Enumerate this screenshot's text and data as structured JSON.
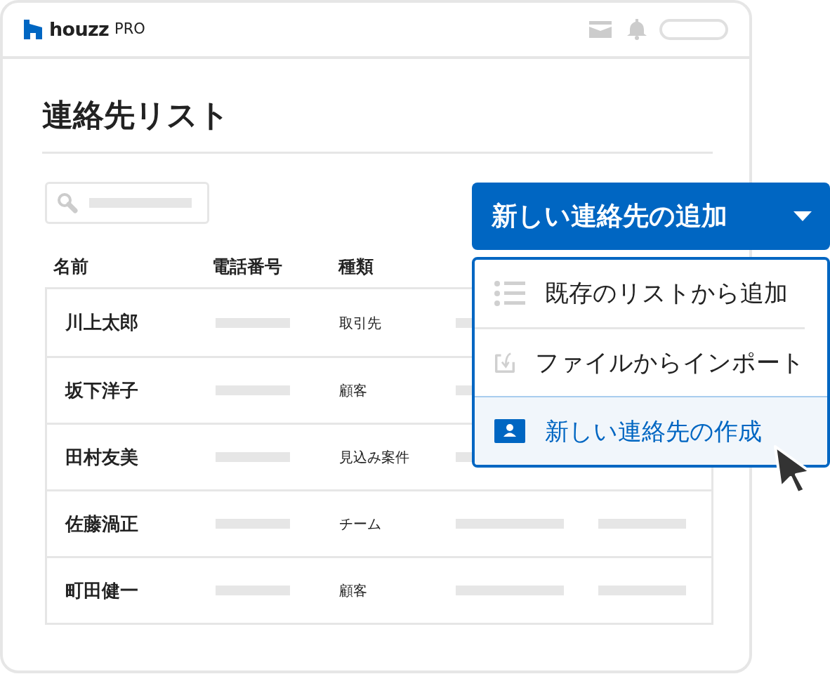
{
  "header": {
    "logo": "houzz",
    "logo_suffix": "PRO"
  },
  "page_title": "連絡先リスト",
  "table": {
    "columns": [
      "名前",
      "電話番号",
      "種類"
    ],
    "rows": [
      {
        "name": "川上太郎",
        "type": "取引先"
      },
      {
        "name": "坂下洋子",
        "type": "顧客"
      },
      {
        "name": "田村友美",
        "type": "見込み案件"
      },
      {
        "name": "佐藤渦正",
        "type": "チーム"
      },
      {
        "name": "町田健一",
        "type": "顧客"
      }
    ]
  },
  "add_button": {
    "label": "新しい連絡先の追加"
  },
  "menu": [
    {
      "kind": "list",
      "label": "既存のリストから追加",
      "selected": false
    },
    {
      "kind": "import",
      "label": "ファイルからインポート",
      "selected": false
    },
    {
      "kind": "contact",
      "label": "新しい連絡先の作成",
      "selected": true
    }
  ]
}
